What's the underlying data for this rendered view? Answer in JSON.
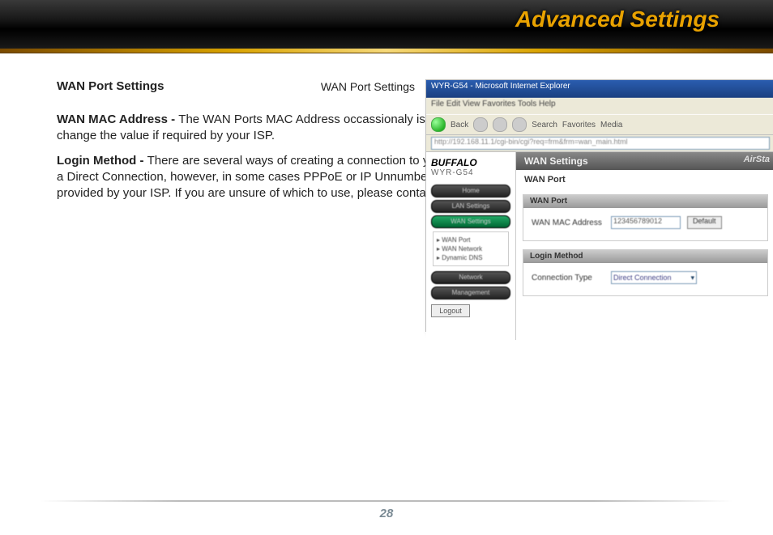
{
  "header": {
    "title": "Advanced Settings"
  },
  "text": {
    "heading": "WAN Port Settings",
    "p1_label": "WAN MAC Address - ",
    "p1_body": "The WAN Ports MAC Address occassionaly is required to be set to a value other than the default. Only change the value if required by your ISP.",
    "p2_label": "Login Method - ",
    "p2_body": "There are several ways of creating a connection to your broadband provider. In most cases, your ISP will use a Direct Connection, however, in some cases PPPoE or IP Unnumbered is used which will require the entering of information provided by your ISP. If you are unsure of which to use, please contact your ISP."
  },
  "caption": "WAN  Port Settings",
  "screenshot": {
    "window_title": "WYR-G54 - Microsoft Internet Explorer",
    "menubar": "File  Edit  View  Favorites  Tools  Help",
    "toolbar": {
      "back": "Back",
      "search": "Search",
      "favorites": "Favorites",
      "media": "Media"
    },
    "address": "http://192.168.11.1/cgi-bin/cgi?req=frm&frm=wan_main.html",
    "logo": "BUFFALO",
    "model": "WYR-G54",
    "nav": [
      "Home",
      "LAN Settings",
      "WAN Settings",
      "Network",
      "Management"
    ],
    "sublist": [
      "WAN Port",
      "WAN Network",
      "Dynamic DNS"
    ],
    "logout": "Logout",
    "tab": "WAN Settings",
    "brand_right": "AirSta",
    "subtab": "WAN Port",
    "panel1": {
      "title": "WAN Port",
      "label": "WAN MAC Address",
      "value": "123456789012",
      "button": "Default"
    },
    "panel2": {
      "title": "Login Method",
      "label": "Connection Type",
      "select": "Direct Connection"
    }
  },
  "page_number": "28"
}
